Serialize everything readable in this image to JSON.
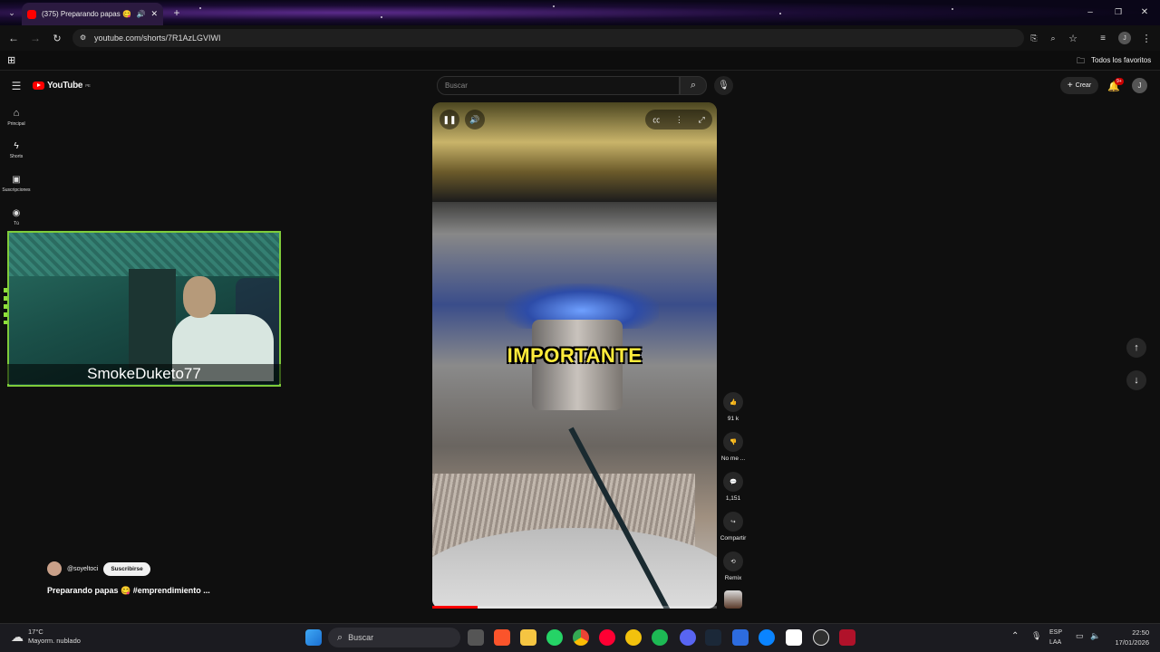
{
  "browser": {
    "tab_title": "(375) Preparando papas 😋",
    "url": "youtube.com/shorts/7R1AzLGVIWI",
    "bookmarks_label": "Todos los favoritos"
  },
  "youtube": {
    "logo_text": "YouTube",
    "region": "PE",
    "search_placeholder": "Buscar",
    "create_label": "Crear",
    "notifications_badge": "9+",
    "avatar_letter": "J",
    "nav": [
      {
        "label": "Principal",
        "icon": "home-icon"
      },
      {
        "label": "Shorts",
        "icon": "shorts-icon"
      },
      {
        "label": "Suscripciones",
        "icon": "subscriptions-icon"
      },
      {
        "label": "Tú",
        "icon": "you-icon"
      }
    ]
  },
  "webcam": {
    "name": "SmokeDuketo77"
  },
  "video": {
    "caption": "IMPORTANTE",
    "progress": 0.16
  },
  "actions": {
    "likes": "91 k",
    "dislike_label": "No me ...",
    "comments": "1,151",
    "share_label": "Compartir",
    "remix_label": "Remix"
  },
  "channel": {
    "handle": "@soyeltoci",
    "subscribe_label": "Suscribirse",
    "title": "Preparando papas 😋 #emprendimiento ..."
  },
  "taskbar": {
    "temp": "17°C",
    "weather": "Mayorm. nublado",
    "search_label": "Buscar",
    "lang_1": "ESP",
    "lang_2": "LAA",
    "time": "22:50",
    "date": "17/01/2026"
  },
  "colors": {
    "accent": "#ff0000",
    "caption": "#ffeb3b",
    "webcam_frame": "#7fcc3a"
  }
}
